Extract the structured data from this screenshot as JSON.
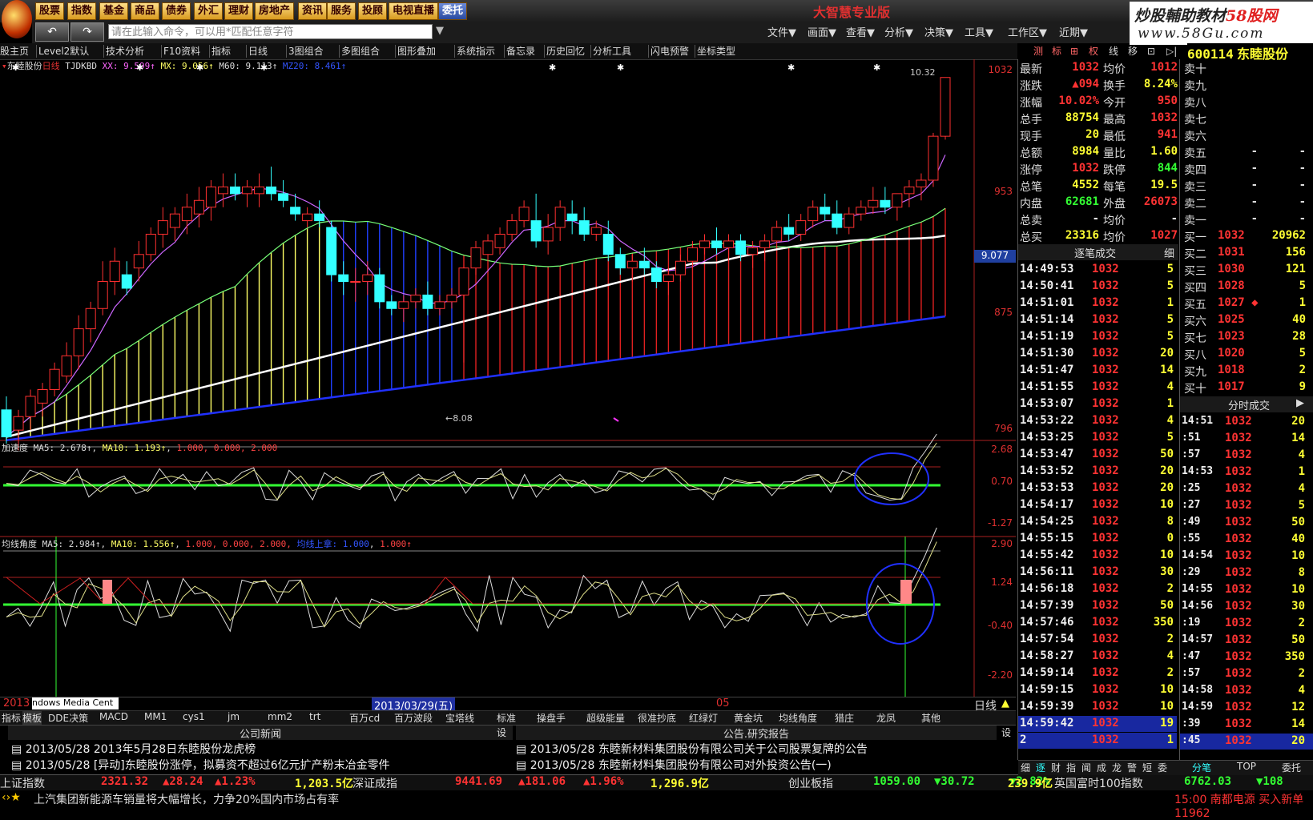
{
  "top_tabs": [
    "股票",
    "指数",
    "基金",
    "商品",
    "债券",
    "外汇",
    "理财",
    "房地产",
    "资讯",
    "服务",
    "投顾",
    "电视直播",
    "委托"
  ],
  "brand_title": "大智慧专业版",
  "watermark": {
    "line1_a": "炒股輔助教材",
    "line1_b": "58股网",
    "line2": "www.58Gu.com"
  },
  "command_placeholder": "请在此输入命令，可以用*匹配任意字符",
  "menu": [
    "文件▼",
    "画面▼",
    "查看▼",
    "分析▼",
    "决策▼",
    "工具▼",
    "工作区▼",
    "近期▼"
  ],
  "row3_tabs": [
    "股主页",
    "Level2默认",
    "技术分析",
    "F10资料",
    "指标",
    "日线",
    "3图组合",
    "多图组合",
    "图形叠加",
    "系统指示",
    "备忘录",
    "历史回忆",
    "分析工具",
    "闪电预警",
    "坐标类型"
  ],
  "row3_right": [
    "测",
    "标",
    "⊞",
    "权",
    "线",
    "移",
    "⊡",
    "▷|"
  ],
  "stock": {
    "code": "600114",
    "name": "东睦股份"
  },
  "kline_label": {
    "name": "东睦股份",
    "period": "日线",
    "formula": "TJDKBD",
    "xx": "XX: 9.599↑",
    "mx": "MX: 9.056↑",
    "m60": "M60: 9.113↑",
    "extra": "MZ20: 8.461↑"
  },
  "kline": {
    "price_labels": [
      "1032",
      "953",
      "875",
      "796"
    ],
    "current_marker": "9.077",
    "low_annotation": "←8.08",
    "top_annotation": "10.32",
    "candles": [
      [
        5.4,
        5.6,
        4.9,
        5.0
      ],
      [
        5.1,
        5.4,
        4.8,
        5.3
      ],
      [
        5.3,
        5.7,
        5.1,
        5.6
      ],
      [
        5.5,
        5.8,
        5.3,
        5.7
      ],
      [
        5.7,
        6.1,
        5.6,
        6.0
      ],
      [
        5.9,
        6.4,
        5.8,
        6.2
      ],
      [
        6.2,
        6.8,
        6.0,
        6.6
      ],
      [
        6.6,
        7.0,
        6.4,
        6.9
      ],
      [
        6.9,
        7.6,
        6.8,
        7.3
      ],
      [
        7.3,
        7.8,
        7.1,
        7.6
      ],
      [
        7.4,
        7.6,
        7.1,
        7.2
      ],
      [
        7.5,
        7.9,
        7.3,
        7.7
      ],
      [
        7.7,
        8.1,
        7.6,
        8.0
      ],
      [
        8.0,
        8.4,
        7.8,
        8.2
      ],
      [
        8.1,
        8.4,
        7.9,
        8.3
      ],
      [
        8.2,
        8.6,
        8.0,
        8.4
      ],
      [
        8.3,
        8.7,
        8.1,
        8.5
      ],
      [
        8.4,
        8.8,
        8.2,
        8.7
      ],
      [
        8.6,
        8.9,
        8.4,
        8.7
      ],
      [
        8.7,
        8.9,
        8.5,
        8.6
      ],
      [
        8.6,
        8.8,
        8.4,
        8.7
      ],
      [
        8.6,
        8.9,
        8.4,
        8.7
      ],
      [
        8.7,
        9.0,
        8.5,
        8.6
      ],
      [
        8.6,
        8.8,
        8.4,
        8.5
      ],
      [
        8.4,
        8.6,
        8.2,
        8.3
      ],
      [
        8.2,
        8.4,
        8.1,
        8.3
      ],
      [
        8.3,
        8.5,
        8.1,
        8.2
      ],
      [
        8.1,
        8.2,
        7.3,
        7.4
      ],
      [
        7.4,
        7.6,
        7.1,
        7.3
      ],
      [
        7.3,
        7.5,
        7.0,
        7.3
      ],
      [
        7.3,
        7.6,
        7.1,
        7.4
      ],
      [
        7.4,
        7.5,
        6.9,
        7.0
      ],
      [
        7.0,
        7.1,
        6.8,
        6.9
      ],
      [
        6.9,
        7.1,
        6.7,
        7.0
      ],
      [
        7.0,
        7.2,
        6.9,
        7.1
      ],
      [
        7.1,
        7.3,
        6.8,
        6.9
      ],
      [
        6.9,
        7.1,
        6.8,
        7.0
      ],
      [
        7.0,
        7.2,
        6.9,
        7.1
      ],
      [
        7.1,
        7.5,
        6.1,
        7.5
      ],
      [
        7.5,
        7.9,
        7.4,
        7.8
      ],
      [
        7.7,
        8.0,
        7.6,
        7.9
      ],
      [
        7.8,
        8.1,
        7.7,
        8.0
      ],
      [
        8.0,
        8.3,
        7.9,
        8.2
      ],
      [
        8.2,
        8.5,
        8.1,
        8.4
      ],
      [
        8.2,
        8.6,
        7.8,
        7.9
      ],
      [
        7.9,
        8.3,
        7.7,
        8.1
      ],
      [
        8.1,
        8.5,
        7.9,
        8.4
      ],
      [
        8.3,
        8.5,
        8.0,
        8.2
      ],
      [
        8.2,
        8.4,
        7.9,
        8.0
      ],
      [
        8.0,
        8.2,
        7.9,
        8.1
      ],
      [
        8.0,
        8.2,
        7.6,
        7.7
      ],
      [
        7.7,
        7.8,
        7.4,
        7.5
      ],
      [
        7.5,
        7.7,
        7.3,
        7.6
      ],
      [
        7.6,
        7.8,
        7.4,
        7.5
      ],
      [
        7.5,
        7.6,
        7.2,
        7.3
      ],
      [
        7.3,
        7.5,
        7.1,
        7.4
      ],
      [
        7.4,
        7.7,
        7.3,
        7.6
      ],
      [
        7.6,
        7.9,
        7.5,
        7.8
      ],
      [
        7.8,
        8.0,
        7.7,
        7.9
      ],
      [
        7.9,
        8.1,
        7.7,
        7.8
      ],
      [
        7.8,
        8.0,
        7.6,
        7.9
      ],
      [
        7.9,
        8.0,
        7.6,
        7.7
      ],
      [
        7.7,
        7.9,
        7.5,
        7.8
      ],
      [
        7.8,
        8.0,
        7.6,
        7.9
      ],
      [
        7.9,
        8.2,
        7.8,
        8.1
      ],
      [
        8.1,
        8.3,
        7.9,
        8.0
      ],
      [
        8.0,
        8.3,
        7.9,
        8.2
      ],
      [
        8.2,
        8.5,
        8.1,
        8.4
      ],
      [
        8.4,
        8.6,
        8.2,
        8.3
      ],
      [
        8.3,
        8.5,
        8.0,
        8.1
      ],
      [
        8.1,
        8.4,
        8.0,
        8.3
      ],
      [
        8.3,
        8.5,
        8.2,
        8.4
      ],
      [
        8.4,
        8.7,
        8.3,
        8.5
      ],
      [
        8.5,
        8.7,
        8.3,
        8.4
      ],
      [
        8.4,
        8.6,
        8.2,
        8.6
      ],
      [
        8.6,
        8.8,
        8.4,
        8.7
      ],
      [
        8.7,
        8.9,
        8.5,
        8.8
      ],
      [
        8.8,
        9.5,
        8.7,
        9.45
      ],
      [
        9.45,
        10.32,
        9.4,
        10.32
      ]
    ]
  },
  "ind1": {
    "title": "加速度",
    "ma5": "MA5: 2.678↑",
    "ma10": "MA10: 1.193↑",
    "vals": "1.000, 0.000, 2.000",
    "levels": [
      "2.68",
      "0.70",
      "-1.27"
    ]
  },
  "ind2": {
    "title": "均线角度",
    "ma5": "MA5: 2.984↑",
    "ma10": "MA10: 1.556↑",
    "vals": "1.000, 0.000, 2.000,",
    "extra": "均线上拿: 1.000",
    "extra2": "1.000↑",
    "levels": [
      "2.90",
      "1.24",
      "-0.40",
      "-2.20"
    ]
  },
  "date_strip": {
    "left": "2013",
    "popup": "ndows Media Cent",
    "date": "2013/03/29(五)",
    "month": "05",
    "period": "日线"
  },
  "indicator_tabs": [
    "指标",
    "模板",
    "DDE决策",
    "MACD",
    "MM1",
    "cys1",
    "jm",
    "mm2",
    "trt",
    "百万cd",
    "百万波段",
    "宝塔线",
    "标准",
    "操盘手",
    "超级能量",
    "很准抄底",
    "红绿灯",
    "黄金坑",
    "均线角度",
    "猎庄",
    "龙凤",
    "其他"
  ],
  "news": {
    "left_header": "公司新闻",
    "right_header": "公告.研究报告",
    "left": [
      {
        "date": "2013/05/28",
        "text": "2013年5月28日东睦股份龙虎榜"
      },
      {
        "date": "2013/05/28",
        "text": "[异动]东睦股份涨停，拟募资不超过6亿元扩产粉末冶金零件"
      }
    ],
    "right": [
      {
        "date": "2013/05/28",
        "text": "东睦新材料集团股份有限公司关于公司股票复牌的公告"
      },
      {
        "date": "2013/05/28",
        "text": "东睦新材料集团股份有限公司对外投资公告(一)"
      }
    ]
  },
  "index_bar": [
    {
      "name": "上证指数",
      "val": "2321.32",
      "chg": "▲28.24",
      "pct": "▲1.23%",
      "amt": "1,203.5亿"
    },
    {
      "name": "深证成指",
      "val": "9441.69",
      "chg": "▲181.06",
      "pct": "▲1.96%",
      "amt": "1,296.9亿"
    },
    {
      "name": "创业板指",
      "val": "1059.00",
      "chg": "▼30.72",
      "pct": "▼2.82%",
      "amt": "239.9亿"
    },
    {
      "name": "英国富时100指数",
      "val": "6762.03",
      "chg": "▼108"
    }
  ],
  "ticker": "上汽集团新能源车销量将大幅增长，力争20%国内市场占有率",
  "ticker_right": "15:00 南都电源 买入新单 11962",
  "quote": [
    {
      "l": "最新",
      "lv": "1032",
      "lc": "red",
      "r": "均价",
      "rv": "1012",
      "rc": "red"
    },
    {
      "l": "涨跌",
      "lv": "▲094",
      "lc": "red",
      "r": "换手",
      "rv": "8.24%",
      "rc": "yel"
    },
    {
      "l": "涨幅",
      "lv": "10.02%",
      "lc": "red",
      "r": "今开",
      "rv": "950",
      "rc": "red"
    },
    {
      "l": "总手",
      "lv": "88754",
      "lc": "yel",
      "r": "最高",
      "rv": "1032",
      "rc": "red"
    },
    {
      "l": "现手",
      "lv": "20",
      "lc": "yel",
      "r": "最低",
      "rv": "941",
      "rc": "red"
    },
    {
      "l": "总额",
      "lv": "8984",
      "lc": "yel",
      "r": "量比",
      "rv": "1.60",
      "rc": "yel"
    },
    {
      "l": "涨停",
      "lv": "1032",
      "lc": "red",
      "r": "跌停",
      "rv": "844",
      "rc": "grn"
    },
    {
      "l": "总笔",
      "lv": "4552",
      "lc": "yel",
      "r": "每笔",
      "rv": "19.5",
      "rc": "yel"
    },
    {
      "l": "内盘",
      "lv": "62681",
      "lc": "grn",
      "r": "外盘",
      "rv": "26073",
      "rc": "red"
    },
    {
      "l": "总卖",
      "lv": "-",
      "lc": "wht",
      "r": "均价",
      "rv": "-",
      "rc": "wht"
    },
    {
      "l": "总买",
      "lv": "23316",
      "lc": "yel",
      "r": "均价",
      "rv": "1027",
      "rc": "red"
    }
  ],
  "sells": [
    {
      "l": "卖十",
      "p": "",
      "v": ""
    },
    {
      "l": "卖九",
      "p": "",
      "v": ""
    },
    {
      "l": "卖八",
      "p": "",
      "v": ""
    },
    {
      "l": "卖七",
      "p": "",
      "v": ""
    },
    {
      "l": "卖六",
      "p": "",
      "v": ""
    },
    {
      "l": "卖五",
      "p": "-",
      "v": "-"
    },
    {
      "l": "卖四",
      "p": "-",
      "v": "-"
    },
    {
      "l": "卖三",
      "p": "-",
      "v": "-"
    },
    {
      "l": "卖二",
      "p": "-",
      "v": "-"
    },
    {
      "l": "卖一",
      "p": "-",
      "v": "-"
    }
  ],
  "buys": [
    {
      "l": "买一",
      "p": "1032",
      "v": "20962"
    },
    {
      "l": "买二",
      "p": "1031",
      "v": "156"
    },
    {
      "l": "买三",
      "p": "1030",
      "v": "121"
    },
    {
      "l": "买四",
      "p": "1028",
      "v": "5"
    },
    {
      "l": "买五",
      "p": "1027 ◆",
      "v": "1"
    },
    {
      "l": "买六",
      "p": "1025",
      "v": "40"
    },
    {
      "l": "买七",
      "p": "1023",
      "v": "28"
    },
    {
      "l": "买八",
      "p": "1020",
      "v": "5"
    },
    {
      "l": "买九",
      "p": "1018",
      "v": "2"
    },
    {
      "l": "买十",
      "p": "1017",
      "v": "9"
    }
  ],
  "trades_header": "逐笔成交",
  "trades_header_right": "细",
  "trades": [
    [
      "14:49:53",
      "1032",
      "5"
    ],
    [
      "14:50:41",
      "1032",
      "5"
    ],
    [
      "14:51:01",
      "1032",
      "1"
    ],
    [
      "14:51:14",
      "1032",
      "5"
    ],
    [
      "14:51:19",
      "1032",
      "5"
    ],
    [
      "14:51:30",
      "1032",
      "20"
    ],
    [
      "14:51:47",
      "1032",
      "14"
    ],
    [
      "14:51:55",
      "1032",
      "4"
    ],
    [
      "14:53:07",
      "1032",
      "1"
    ],
    [
      "14:53:22",
      "1032",
      "4"
    ],
    [
      "14:53:25",
      "1032",
      "5"
    ],
    [
      "14:53:47",
      "1032",
      "50"
    ],
    [
      "14:53:52",
      "1032",
      "20"
    ],
    [
      "14:53:53",
      "1032",
      "20"
    ],
    [
      "14:54:17",
      "1032",
      "10"
    ],
    [
      "14:54:25",
      "1032",
      "8"
    ],
    [
      "14:55:15",
      "1032",
      "0"
    ],
    [
      "14:55:42",
      "1032",
      "10"
    ],
    [
      "14:56:11",
      "1032",
      "30"
    ],
    [
      "14:56:18",
      "1032",
      "2"
    ],
    [
      "14:57:39",
      "1032",
      "50"
    ],
    [
      "14:57:46",
      "1032",
      "350"
    ],
    [
      "14:57:54",
      "1032",
      "2"
    ],
    [
      "14:58:27",
      "1032",
      "4"
    ],
    [
      "14:59:14",
      "1032",
      "2"
    ],
    [
      "14:59:15",
      "1032",
      "10"
    ],
    [
      "14:59:39",
      "1032",
      "10"
    ],
    [
      "14:59:42",
      "1032",
      "19"
    ],
    [
      "2",
      "1032",
      "1"
    ]
  ],
  "ticks_header": "分时成交",
  "ticks": [
    [
      "14:51",
      "1032",
      "20"
    ],
    [
      ":51",
      "1032",
      "14"
    ],
    [
      ":57",
      "1032",
      "4"
    ],
    [
      "14:53",
      "1032",
      "1"
    ],
    [
      ":25",
      "1032",
      "4"
    ],
    [
      ":27",
      "1032",
      "5"
    ],
    [
      ":49",
      "1032",
      "50"
    ],
    [
      ":55",
      "1032",
      "40"
    ],
    [
      "14:54",
      "1032",
      "10"
    ],
    [
      ":29",
      "1032",
      "8"
    ],
    [
      "14:55",
      "1032",
      "10"
    ],
    [
      "14:56",
      "1032",
      "30"
    ],
    [
      ":19",
      "1032",
      "2"
    ],
    [
      "14:57",
      "1032",
      "50"
    ],
    [
      ":47",
      "1032",
      "350"
    ],
    [
      ":57",
      "1032",
      "2"
    ],
    [
      "14:58",
      "1032",
      "4"
    ],
    [
      "14:59",
      "1032",
      "12"
    ],
    [
      ":39",
      "1032",
      "14"
    ],
    [
      ":45",
      "1032",
      "20"
    ]
  ],
  "right_bottom_tabs": [
    "细",
    "逐",
    "财",
    "指",
    "闻",
    "成",
    "龙",
    "警",
    "短",
    "委"
  ],
  "right_bottom_tabs2": [
    "分笔",
    "TOP",
    "委托"
  ]
}
